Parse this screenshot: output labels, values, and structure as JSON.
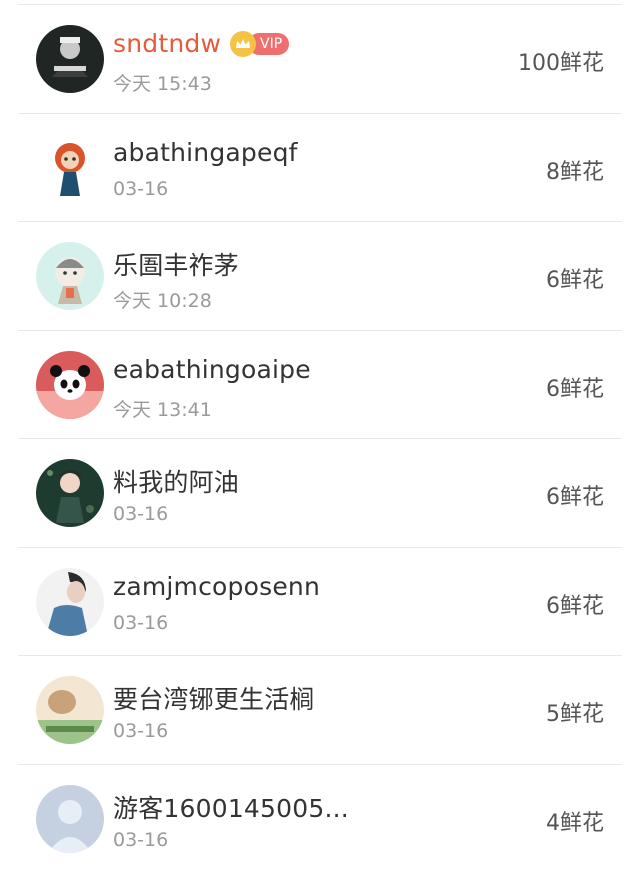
{
  "list": {
    "rows": [
      {
        "name": "sndtndw",
        "time": "今天 15:43",
        "flowers": "100鲜花",
        "vip_badge": "VIP",
        "highlight": true,
        "avatar_icon": "avatar-coup-detat-icon"
      },
      {
        "name": "abathingapeqf",
        "time": "03-16",
        "flowers": "8鲜花",
        "avatar_icon": "avatar-cartoon-girl-icon"
      },
      {
        "name": "乐圄丰祚茅",
        "time": "今天 10:28",
        "flowers": "6鲜花",
        "avatar_icon": "avatar-cartoon-cat-icon"
      },
      {
        "name": "eabathingoaipe",
        "time": "今天 13:41",
        "flowers": "6鲜花",
        "avatar_icon": "avatar-panda-icon"
      },
      {
        "name": "料我的阿油",
        "time": "03-16",
        "flowers": "6鲜花",
        "avatar_icon": "avatar-girl-photo-icon"
      },
      {
        "name": "zamjmcoposenn",
        "time": "03-16",
        "flowers": "6鲜花",
        "avatar_icon": "avatar-man-photo-icon"
      },
      {
        "name": "要台湾铘更生活榈",
        "time": "03-16",
        "flowers": "5鲜花",
        "avatar_icon": "avatar-landscape-icon"
      },
      {
        "name": "游客1600145005...",
        "time": "03-16",
        "flowers": "4鲜花",
        "avatar_icon": "default-avatar-icon"
      }
    ]
  },
  "colors": {
    "highlight_name": "#e55b3c",
    "vip_badge": "#ef6f6f",
    "crown": "#f6c244",
    "text": "#333333",
    "muted": "#9a9a9a",
    "divider": "#e8e8e8"
  }
}
